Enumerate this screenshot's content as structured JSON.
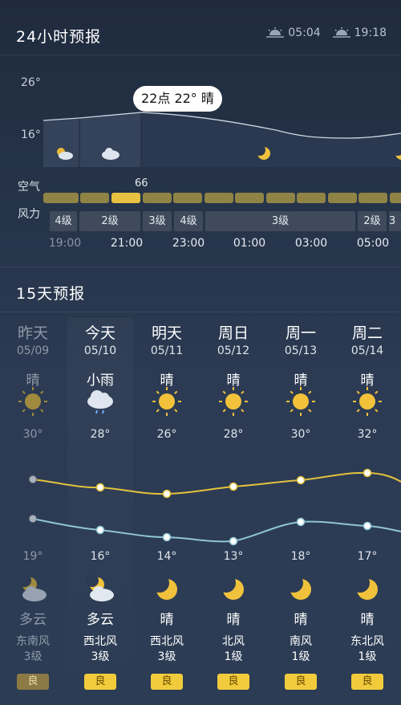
{
  "hourly": {
    "title": "24小时预报",
    "sunrise": "05:04",
    "sunset": "19:18",
    "axis_top": "26°",
    "axis_bottom": "16°",
    "tooltip": "22点 22° 晴",
    "aqi_label": "空气",
    "wind_label": "风力",
    "aqi_value": "66",
    "wind_segments": [
      "4级",
      "2级",
      "3级",
      "4级",
      "3级",
      "2级",
      "3"
    ],
    "times": [
      "19:00",
      "21:00",
      "23:00",
      "01:00",
      "03:00",
      "05:00"
    ]
  },
  "daily": {
    "title": "15天预报",
    "days": [
      {
        "name": "昨天",
        "date": "05/09",
        "day_cond": "晴",
        "day_icon": "sun-icon",
        "high": "30°",
        "low": "19°",
        "night_icon": "cloudy-night-icon",
        "night_cond": "多云",
        "wind_dir": "东南风",
        "wind_lvl": "3级",
        "aqi": "良",
        "past": true
      },
      {
        "name": "今天",
        "date": "05/10",
        "day_cond": "小雨",
        "day_icon": "rain-icon",
        "high": "28°",
        "low": "16°",
        "night_icon": "cloudy-night-icon",
        "night_cond": "多云",
        "wind_dir": "西北风",
        "wind_lvl": "3级",
        "aqi": "良"
      },
      {
        "name": "明天",
        "date": "05/11",
        "day_cond": "晴",
        "day_icon": "sun-icon",
        "high": "26°",
        "low": "14°",
        "night_icon": "moon-icon",
        "night_cond": "晴",
        "wind_dir": "西北风",
        "wind_lvl": "3级",
        "aqi": "良"
      },
      {
        "name": "周日",
        "date": "05/12",
        "day_cond": "晴",
        "day_icon": "sun-icon",
        "high": "28°",
        "low": "13°",
        "night_icon": "moon-icon",
        "night_cond": "晴",
        "wind_dir": "北风",
        "wind_lvl": "1级",
        "aqi": "良"
      },
      {
        "name": "周一",
        "date": "05/13",
        "day_cond": "晴",
        "day_icon": "sun-icon",
        "high": "30°",
        "low": "18°",
        "night_icon": "moon-icon",
        "night_cond": "晴",
        "wind_dir": "南风",
        "wind_lvl": "1级",
        "aqi": "良"
      },
      {
        "name": "周二",
        "date": "05/14",
        "day_cond": "晴",
        "day_icon": "sun-icon",
        "high": "32°",
        "low": "17°",
        "night_icon": "moon-icon",
        "night_cond": "晴",
        "wind_dir": "东北风",
        "wind_lvl": "1级",
        "aqi": "良"
      }
    ]
  },
  "colors": {
    "accent_yellow": "#f1cb3b",
    "high_line": "#e3c23d",
    "low_line": "#8fc6d3"
  }
}
